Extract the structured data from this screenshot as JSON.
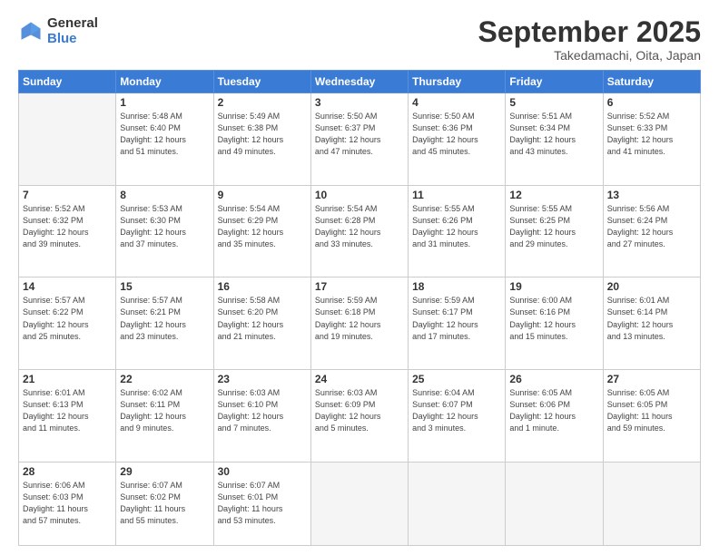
{
  "logo": {
    "general": "General",
    "blue": "Blue"
  },
  "header": {
    "month": "September 2025",
    "location": "Takedamachi, Oita, Japan"
  },
  "weekdays": [
    "Sunday",
    "Monday",
    "Tuesday",
    "Wednesday",
    "Thursday",
    "Friday",
    "Saturday"
  ],
  "weeks": [
    [
      {
        "day": "",
        "info": ""
      },
      {
        "day": "1",
        "info": "Sunrise: 5:48 AM\nSunset: 6:40 PM\nDaylight: 12 hours\nand 51 minutes."
      },
      {
        "day": "2",
        "info": "Sunrise: 5:49 AM\nSunset: 6:38 PM\nDaylight: 12 hours\nand 49 minutes."
      },
      {
        "day": "3",
        "info": "Sunrise: 5:50 AM\nSunset: 6:37 PM\nDaylight: 12 hours\nand 47 minutes."
      },
      {
        "day": "4",
        "info": "Sunrise: 5:50 AM\nSunset: 6:36 PM\nDaylight: 12 hours\nand 45 minutes."
      },
      {
        "day": "5",
        "info": "Sunrise: 5:51 AM\nSunset: 6:34 PM\nDaylight: 12 hours\nand 43 minutes."
      },
      {
        "day": "6",
        "info": "Sunrise: 5:52 AM\nSunset: 6:33 PM\nDaylight: 12 hours\nand 41 minutes."
      }
    ],
    [
      {
        "day": "7",
        "info": "Sunrise: 5:52 AM\nSunset: 6:32 PM\nDaylight: 12 hours\nand 39 minutes."
      },
      {
        "day": "8",
        "info": "Sunrise: 5:53 AM\nSunset: 6:30 PM\nDaylight: 12 hours\nand 37 minutes."
      },
      {
        "day": "9",
        "info": "Sunrise: 5:54 AM\nSunset: 6:29 PM\nDaylight: 12 hours\nand 35 minutes."
      },
      {
        "day": "10",
        "info": "Sunrise: 5:54 AM\nSunset: 6:28 PM\nDaylight: 12 hours\nand 33 minutes."
      },
      {
        "day": "11",
        "info": "Sunrise: 5:55 AM\nSunset: 6:26 PM\nDaylight: 12 hours\nand 31 minutes."
      },
      {
        "day": "12",
        "info": "Sunrise: 5:55 AM\nSunset: 6:25 PM\nDaylight: 12 hours\nand 29 minutes."
      },
      {
        "day": "13",
        "info": "Sunrise: 5:56 AM\nSunset: 6:24 PM\nDaylight: 12 hours\nand 27 minutes."
      }
    ],
    [
      {
        "day": "14",
        "info": "Sunrise: 5:57 AM\nSunset: 6:22 PM\nDaylight: 12 hours\nand 25 minutes."
      },
      {
        "day": "15",
        "info": "Sunrise: 5:57 AM\nSunset: 6:21 PM\nDaylight: 12 hours\nand 23 minutes."
      },
      {
        "day": "16",
        "info": "Sunrise: 5:58 AM\nSunset: 6:20 PM\nDaylight: 12 hours\nand 21 minutes."
      },
      {
        "day": "17",
        "info": "Sunrise: 5:59 AM\nSunset: 6:18 PM\nDaylight: 12 hours\nand 19 minutes."
      },
      {
        "day": "18",
        "info": "Sunrise: 5:59 AM\nSunset: 6:17 PM\nDaylight: 12 hours\nand 17 minutes."
      },
      {
        "day": "19",
        "info": "Sunrise: 6:00 AM\nSunset: 6:16 PM\nDaylight: 12 hours\nand 15 minutes."
      },
      {
        "day": "20",
        "info": "Sunrise: 6:01 AM\nSunset: 6:14 PM\nDaylight: 12 hours\nand 13 minutes."
      }
    ],
    [
      {
        "day": "21",
        "info": "Sunrise: 6:01 AM\nSunset: 6:13 PM\nDaylight: 12 hours\nand 11 minutes."
      },
      {
        "day": "22",
        "info": "Sunrise: 6:02 AM\nSunset: 6:11 PM\nDaylight: 12 hours\nand 9 minutes."
      },
      {
        "day": "23",
        "info": "Sunrise: 6:03 AM\nSunset: 6:10 PM\nDaylight: 12 hours\nand 7 minutes."
      },
      {
        "day": "24",
        "info": "Sunrise: 6:03 AM\nSunset: 6:09 PM\nDaylight: 12 hours\nand 5 minutes."
      },
      {
        "day": "25",
        "info": "Sunrise: 6:04 AM\nSunset: 6:07 PM\nDaylight: 12 hours\nand 3 minutes."
      },
      {
        "day": "26",
        "info": "Sunrise: 6:05 AM\nSunset: 6:06 PM\nDaylight: 12 hours\nand 1 minute."
      },
      {
        "day": "27",
        "info": "Sunrise: 6:05 AM\nSunset: 6:05 PM\nDaylight: 11 hours\nand 59 minutes."
      }
    ],
    [
      {
        "day": "28",
        "info": "Sunrise: 6:06 AM\nSunset: 6:03 PM\nDaylight: 11 hours\nand 57 minutes."
      },
      {
        "day": "29",
        "info": "Sunrise: 6:07 AM\nSunset: 6:02 PM\nDaylight: 11 hours\nand 55 minutes."
      },
      {
        "day": "30",
        "info": "Sunrise: 6:07 AM\nSunset: 6:01 PM\nDaylight: 11 hours\nand 53 minutes."
      },
      {
        "day": "",
        "info": ""
      },
      {
        "day": "",
        "info": ""
      },
      {
        "day": "",
        "info": ""
      },
      {
        "day": "",
        "info": ""
      }
    ]
  ]
}
